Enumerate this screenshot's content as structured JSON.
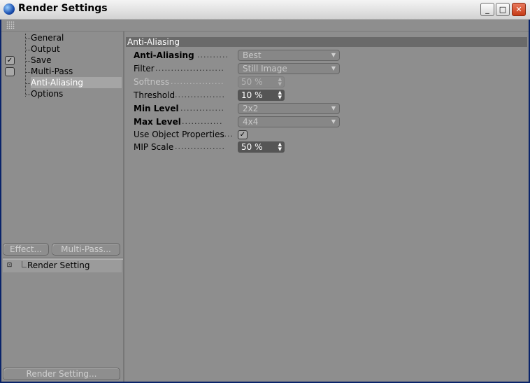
{
  "window": {
    "title": "Render Settings",
    "controls": {
      "minimize": "_",
      "maximize": "□",
      "close": "✕"
    }
  },
  "icons": {
    "app": "cinema4d-sphere-icon",
    "toolbar": "grip-icon",
    "checkmark": "✓",
    "expand": "⊡",
    "dropdown_arrow": "▼",
    "spinner_arrows": "▲▼"
  },
  "sidebar": {
    "items": [
      {
        "label": "General",
        "checkbox": false,
        "selected": false
      },
      {
        "label": "Output",
        "checkbox": false,
        "selected": false
      },
      {
        "label": "Save",
        "checkbox": true,
        "checked": true,
        "selected": false
      },
      {
        "label": "Multi-Pass",
        "checkbox": true,
        "checked": false,
        "selected": false
      },
      {
        "label": "Anti-Aliasing",
        "checkbox": false,
        "selected": true
      },
      {
        "label": "Options",
        "checkbox": false,
        "selected": false
      }
    ],
    "buttons": {
      "effect": "Effect...",
      "multipass": "Multi-Pass..."
    },
    "render_setting_item": "Render Setting",
    "render_setting_button": "Render Setting..."
  },
  "section": {
    "title": "Anti-Aliasing",
    "rows": {
      "anti_aliasing": {
        "label": "Anti-Aliasing",
        "value": "Best"
      },
      "filter": {
        "label": "Filter",
        "value": "Still Image"
      },
      "softness": {
        "label": "Softness",
        "value": "50 %"
      },
      "threshold": {
        "label": "Threshold",
        "value": "10 %"
      },
      "min_level": {
        "label": "Min Level",
        "value": "2x2"
      },
      "max_level": {
        "label": "Max Level",
        "value": "4x4"
      },
      "use_object_properties": {
        "label": "Use Object Properties",
        "checked": true
      },
      "mip_scale": {
        "label": "MIP Scale",
        "value": "50 %"
      }
    }
  },
  "colors": {
    "panel": "#8e8e8e",
    "header": "#6a6a6a",
    "selected": "#a5a5a5",
    "spinner": "#555555"
  }
}
